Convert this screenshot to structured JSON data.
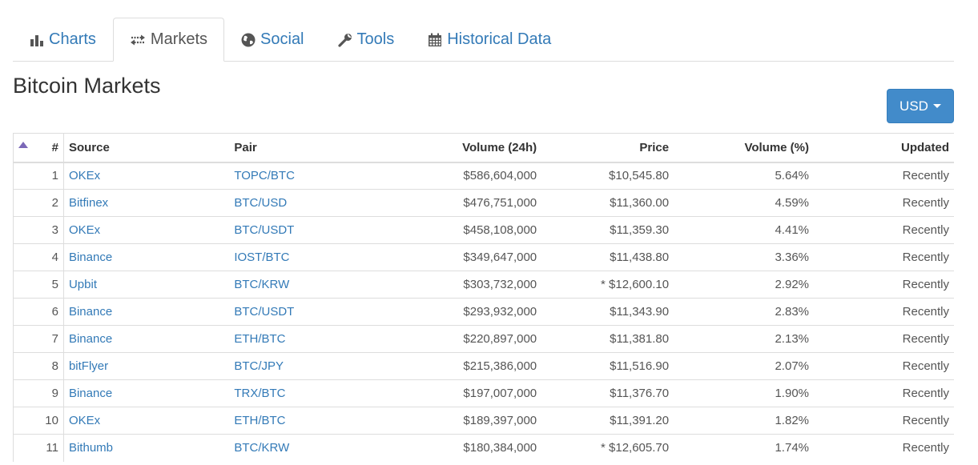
{
  "tabs": [
    {
      "label": "Charts",
      "icon": "bar-chart-icon"
    },
    {
      "label": "Markets",
      "icon": "exchange-arrows-icon"
    },
    {
      "label": "Social",
      "icon": "globe-icon"
    },
    {
      "label": "Tools",
      "icon": "wrench-icon"
    },
    {
      "label": "Historical Data",
      "icon": "calendar-icon"
    }
  ],
  "active_tab": "Markets",
  "page_title": "Bitcoin Markets",
  "currency_button": {
    "label": "USD"
  },
  "table": {
    "headers": {
      "rank": "#",
      "source": "Source",
      "pair": "Pair",
      "volume": "Volume (24h)",
      "price": "Price",
      "volume_pct": "Volume (%)",
      "updated": "Updated"
    },
    "rows": [
      {
        "rank": "1",
        "source": "OKEx",
        "pair": "TOPC/BTC",
        "volume": "$586,604,000",
        "price": "$10,545.80",
        "volume_pct": "5.64%",
        "updated": "Recently"
      },
      {
        "rank": "2",
        "source": "Bitfinex",
        "pair": "BTC/USD",
        "volume": "$476,751,000",
        "price": "$11,360.00",
        "volume_pct": "4.59%",
        "updated": "Recently"
      },
      {
        "rank": "3",
        "source": "OKEx",
        "pair": "BTC/USDT",
        "volume": "$458,108,000",
        "price": "$11,359.30",
        "volume_pct": "4.41%",
        "updated": "Recently"
      },
      {
        "rank": "4",
        "source": "Binance",
        "pair": "IOST/BTC",
        "volume": "$349,647,000",
        "price": "$11,438.80",
        "volume_pct": "3.36%",
        "updated": "Recently"
      },
      {
        "rank": "5",
        "source": "Upbit",
        "pair": "BTC/KRW",
        "volume": "$303,732,000",
        "price": "* $12,600.10",
        "volume_pct": "2.92%",
        "updated": "Recently"
      },
      {
        "rank": "6",
        "source": "Binance",
        "pair": "BTC/USDT",
        "volume": "$293,932,000",
        "price": "$11,343.90",
        "volume_pct": "2.83%",
        "updated": "Recently"
      },
      {
        "rank": "7",
        "source": "Binance",
        "pair": "ETH/BTC",
        "volume": "$220,897,000",
        "price": "$11,381.80",
        "volume_pct": "2.13%",
        "updated": "Recently"
      },
      {
        "rank": "8",
        "source": "bitFlyer",
        "pair": "BTC/JPY",
        "volume": "$215,386,000",
        "price": "$11,516.90",
        "volume_pct": "2.07%",
        "updated": "Recently"
      },
      {
        "rank": "9",
        "source": "Binance",
        "pair": "TRX/BTC",
        "volume": "$197,007,000",
        "price": "$11,376.70",
        "volume_pct": "1.90%",
        "updated": "Recently"
      },
      {
        "rank": "10",
        "source": "OKEx",
        "pair": "ETH/BTC",
        "volume": "$189,397,000",
        "price": "$11,391.20",
        "volume_pct": "1.82%",
        "updated": "Recently"
      },
      {
        "rank": "11",
        "source": "Bithumb",
        "pair": "BTC/KRW",
        "volume": "$180,384,000",
        "price": "* $12,605.70",
        "volume_pct": "1.74%",
        "updated": "Recently"
      }
    ]
  },
  "colors": {
    "link": "#337ab7",
    "button_bg": "#428bca",
    "sort_arrow": "#7b68b8",
    "border": "#dddddd"
  }
}
